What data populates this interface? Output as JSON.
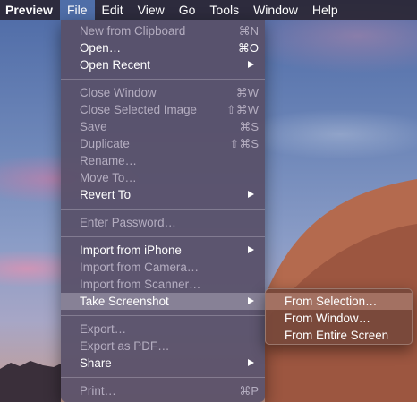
{
  "menubar": {
    "app_name": "Preview",
    "items": [
      "File",
      "Edit",
      "View",
      "Go",
      "Tools",
      "Window",
      "Help"
    ]
  },
  "file_menu": {
    "items": [
      {
        "label": "New from Clipboard",
        "shortcut": "⌘N",
        "enabled": false
      },
      {
        "label": "Open…",
        "shortcut": "⌘O",
        "enabled": true
      },
      {
        "label": "Open Recent",
        "submenu": true,
        "enabled": true
      },
      {
        "label": "Close Window",
        "shortcut": "⌘W",
        "enabled": false
      },
      {
        "label": "Close Selected Image",
        "shortcut": "⇧⌘W",
        "enabled": false
      },
      {
        "label": "Save",
        "shortcut": "⌘S",
        "enabled": false
      },
      {
        "label": "Duplicate",
        "shortcut": "⇧⌘S",
        "enabled": false
      },
      {
        "label": "Rename…",
        "enabled": false
      },
      {
        "label": "Move To…",
        "enabled": false
      },
      {
        "label": "Revert To",
        "submenu": true,
        "enabled": true
      },
      {
        "label": "Enter Password…",
        "enabled": false
      },
      {
        "label": "Import from iPhone",
        "submenu": true,
        "enabled": true
      },
      {
        "label": "Import from Camera…",
        "enabled": false
      },
      {
        "label": "Import from Scanner…",
        "enabled": false
      },
      {
        "label": "Take Screenshot",
        "submenu": true,
        "enabled": true,
        "highlighted": true
      },
      {
        "label": "Export…",
        "enabled": false
      },
      {
        "label": "Export as PDF…",
        "enabled": false
      },
      {
        "label": "Share",
        "submenu": true,
        "enabled": true
      },
      {
        "label": "Print…",
        "shortcut": "⌘P",
        "enabled": false
      }
    ]
  },
  "screenshot_submenu": {
    "items": [
      "From Selection…",
      "From Window…",
      "From Entire Screen"
    ]
  },
  "colors": {
    "menubar_bg": "#2a2634",
    "active_menu": "#4f6ea8",
    "menu_bg": "#585068",
    "disabled_text": "#b4adc0"
  }
}
